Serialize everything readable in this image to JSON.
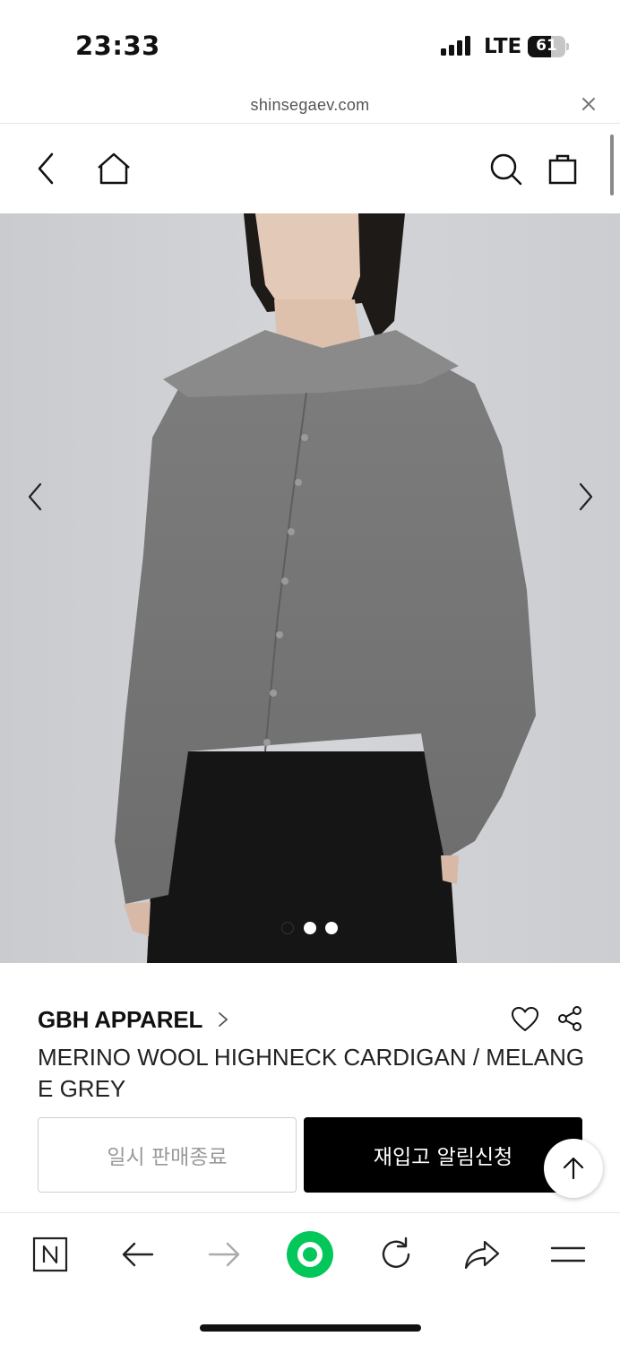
{
  "status_bar": {
    "time": "23:33",
    "network": "LTE",
    "battery": "61",
    "battery_level": 0.61
  },
  "browser": {
    "url": "shinsegaev.com",
    "close_icon": "close-icon"
  },
  "header": {
    "icons": [
      "back-icon",
      "home-icon",
      "search-icon",
      "shopping-bag-icon"
    ]
  },
  "gallery": {
    "image_alt": "model wearing grey knit cardigan",
    "prev_icon": "chevron-left-icon",
    "next_icon": "chevron-right-icon",
    "slide_count": 3,
    "active_index": 0
  },
  "product": {
    "brand": "GBH APPAREL",
    "name": "MERINO WOOL HIGHNECK CARDIGAN / MELANGE GREY",
    "wishlist_icon": "heart-icon",
    "share_icon": "share-icon"
  },
  "actions": {
    "soldout_label": "일시 판매종료",
    "restock_label": "재입고 알림신청",
    "top_icon": "arrow-up-icon"
  },
  "toolbar": {
    "icons": [
      "naver-n-icon",
      "arrow-left-icon",
      "arrow-right-icon",
      "green-circle-icon",
      "refresh-icon",
      "share-arrow-icon",
      "menu-icon"
    ]
  },
  "colors": {
    "accent_green": "#03c75a",
    "button_black": "#000000",
    "muted_text": "#9a9a9a"
  }
}
